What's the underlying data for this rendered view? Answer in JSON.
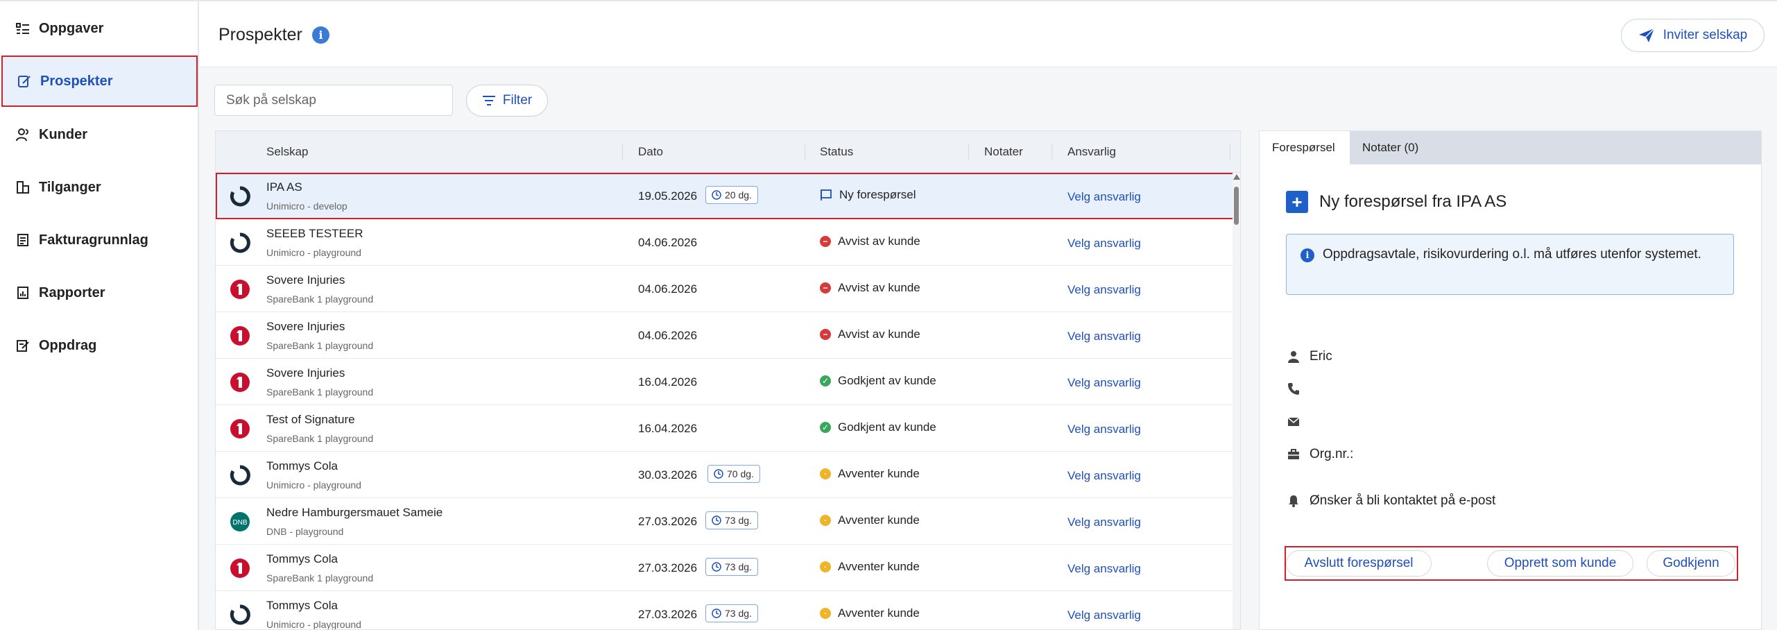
{
  "sidebar": {
    "items": [
      {
        "label": "Oppgaver",
        "icon": "task-list-icon"
      },
      {
        "label": "Prospekter",
        "icon": "edit-note-icon",
        "active": true
      },
      {
        "label": "Kunder",
        "icon": "people-icon"
      },
      {
        "label": "Tilganger",
        "icon": "access-icon"
      },
      {
        "label": "Fakturagrunnlag",
        "icon": "invoice-icon"
      },
      {
        "label": "Rapporter",
        "icon": "report-icon"
      },
      {
        "label": "Oppdrag",
        "icon": "assignment-icon"
      }
    ]
  },
  "header": {
    "title": "Prospekter",
    "info_icon": "i",
    "invite_label": "Inviter selskap"
  },
  "toolbar": {
    "search_placeholder": "Søk på selskap",
    "filter_label": "Filter"
  },
  "table": {
    "columns": [
      "Selskap",
      "Dato",
      "Status",
      "Notater",
      "Ansvarlig"
    ],
    "rows": [
      {
        "company": "IPA AS",
        "sub": "Unimicro - develop",
        "date": "19.05.2026",
        "days": "20 dg.",
        "status": "Ny forespørsel",
        "status_type": "new",
        "assign": "Velg ansvarlig",
        "logo": "unimicro",
        "selected": true
      },
      {
        "company": "SEEEB TESTEER",
        "sub": "Unimicro - playground",
        "date": "04.06.2026",
        "days": "",
        "status": "Avvist av kunde",
        "status_type": "rejected",
        "assign": "Velg ansvarlig",
        "logo": "unimicro"
      },
      {
        "company": "Sovere Injuries",
        "sub": "SpareBank 1 playground",
        "date": "04.06.2026",
        "days": "",
        "status": "Avvist av kunde",
        "status_type": "rejected",
        "assign": "Velg ansvarlig",
        "logo": "sparebank"
      },
      {
        "company": "Sovere Injuries",
        "sub": "SpareBank 1 playground",
        "date": "04.06.2026",
        "days": "",
        "status": "Avvist av kunde",
        "status_type": "rejected",
        "assign": "Velg ansvarlig",
        "logo": "sparebank"
      },
      {
        "company": "Sovere Injuries",
        "sub": "SpareBank 1 playground",
        "date": "16.04.2026",
        "days": "",
        "status": "Godkjent av kunde",
        "status_type": "approved",
        "assign": "Velg ansvarlig",
        "logo": "sparebank"
      },
      {
        "company": "Test of Signature",
        "sub": "SpareBank 1 playground",
        "date": "16.04.2026",
        "days": "",
        "status": "Godkjent av kunde",
        "status_type": "approved",
        "assign": "Velg ansvarlig",
        "logo": "sparebank"
      },
      {
        "company": "Tommys Cola",
        "sub": "Unimicro - playground",
        "date": "30.03.2026",
        "days": "70 dg.",
        "status": "Avventer kunde",
        "status_type": "waiting",
        "assign": "Velg ansvarlig",
        "logo": "unimicro"
      },
      {
        "company": "Nedre Hamburgersmauet Sameie",
        "sub": "DNB - playground",
        "date": "27.03.2026",
        "days": "73 dg.",
        "status": "Avventer kunde",
        "status_type": "waiting",
        "assign": "Velg ansvarlig",
        "logo": "dnb"
      },
      {
        "company": "Tommys Cola",
        "sub": "SpareBank 1 playground",
        "date": "27.03.2026",
        "days": "73 dg.",
        "status": "Avventer kunde",
        "status_type": "waiting",
        "assign": "Velg ansvarlig",
        "logo": "sparebank"
      },
      {
        "company": "Tommys Cola",
        "sub": "Unimicro - playground",
        "date": "27.03.2026",
        "days": "73 dg.",
        "status": "Avventer kunde",
        "status_type": "waiting",
        "assign": "Velg ansvarlig",
        "logo": "unimicro"
      }
    ]
  },
  "panel": {
    "tabs": [
      "Forespørsel",
      "Notater (0)"
    ],
    "title": "Ny forespørsel fra IPA AS",
    "alert": "Oppdragsavtale, risikovurdering o.l. må utføres utenfor systemet.",
    "contact_name": "Eric",
    "phone": "",
    "email": "",
    "org_label": "Org.nr.:",
    "notify": "Ønsker å bli kontaktet på e-post",
    "buttons": {
      "close": "Avslutt forespørsel",
      "create": "Opprett som kunde",
      "approve": "Godkjenn"
    }
  },
  "colors": {
    "accent": "#1f4fb8",
    "highlight_border": "#d0202a",
    "rejected": "#d63a3a",
    "approved": "#3aa65c",
    "waiting": "#f0b429",
    "sparebank": "#c8102e",
    "dnb": "#00736b"
  }
}
